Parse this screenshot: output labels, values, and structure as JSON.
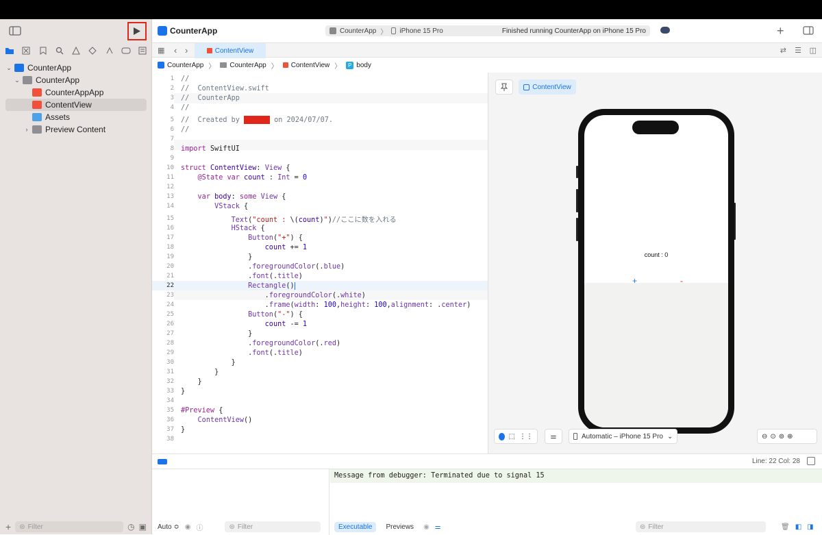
{
  "toolbar": {
    "app_title": "CounterApp",
    "scheme": "CounterApp",
    "device": "iPhone 15 Pro",
    "status": "Finished running CounterApp on iPhone 15 Pro"
  },
  "sidebar": {
    "tree": [
      {
        "label": "CounterApp",
        "kind": "project",
        "indent": 0
      },
      {
        "label": "CounterApp",
        "kind": "folder",
        "indent": 1
      },
      {
        "label": "CounterAppApp",
        "kind": "swift",
        "indent": 2
      },
      {
        "label": "ContentView",
        "kind": "swift",
        "indent": 2,
        "selected": true
      },
      {
        "label": "Assets",
        "kind": "assets",
        "indent": 2
      },
      {
        "label": "Preview Content",
        "kind": "folder",
        "indent": 2
      }
    ],
    "filter_placeholder": "Filter"
  },
  "tabs": {
    "active": "ContentView"
  },
  "jumpbar": [
    "CounterApp",
    "CounterApp",
    "ContentView",
    "body"
  ],
  "editor": {
    "current_line": 22,
    "lines": [
      "//",
      "//  ContentView.swift",
      "//  CounterApp",
      "//",
      "//  Created by ",
      "//",
      "",
      "import SwiftUI",
      "",
      "struct ContentView: View {",
      "    @State var count : Int = 0",
      "",
      "    var body: some View {",
      "        VStack {",
      "            Text(\"count : \\(count)\")//ここに数を入れる",
      "            HStack {",
      "                Button(\"+\") {",
      "                    count += 1",
      "                }",
      "                .foregroundColor(.blue)",
      "                .font(.title)",
      "                Rectangle()",
      "                    .foregroundColor(.white)",
      "                    .frame(width: 100,height: 100,alignment: .center)",
      "                Button(\"-\") {",
      "                    count -= 1",
      "                }",
      "                .foregroundColor(.red)",
      "                .font(.title)",
      "            }",
      "        }",
      "    }",
      "}",
      "",
      "#Preview {",
      "    ContentView()",
      "}",
      ""
    ],
    "created_suffix": " on 2024/07/07."
  },
  "canvas": {
    "preview_label": "ContentView",
    "count_text": "count : 0",
    "plus": "+",
    "minus": "-",
    "device_selector": "Automatic – iPhone 15 Pro"
  },
  "status": {
    "line_col": "Line: 22  Col: 28"
  },
  "debug": {
    "console_message": "Message from debugger: Terminated due to signal 15",
    "auto_label": "Auto ≎",
    "filter_placeholder": "Filter",
    "tab_executable": "Executable",
    "tab_previews": "Previews"
  },
  "colors": {
    "accent": "#1a73e8",
    "run_highlight": "#e0261b",
    "swift_orange": "#f05138"
  }
}
